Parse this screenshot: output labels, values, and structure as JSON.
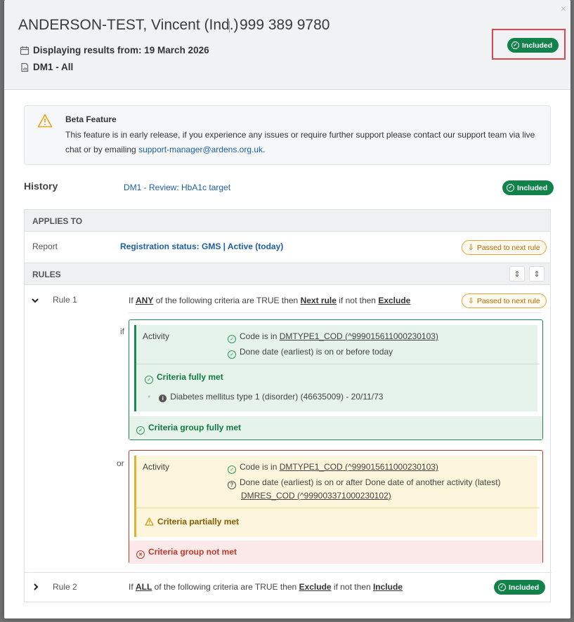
{
  "header": {
    "patient_name": "ANDERSON-TEST, Vincent (Ind.)",
    "nhs_number": "999 389 9780",
    "displaying_label": "Displaying results from: 19 March 2026",
    "report_label": "DM1 - All",
    "status_pill": "Included",
    "close": "×"
  },
  "beta": {
    "title": "Beta Feature",
    "body_prefix": "This feature is in early release, if you experience any issues or require further support please contact our support team via live chat or by emailing ",
    "email": "support-manager@ardens.org.uk",
    "body_suffix": "."
  },
  "history": {
    "label": "History",
    "link": "DM1 - Review: HbA1c target",
    "status_pill": "Included"
  },
  "applies_to": {
    "heading": "APPLIES TO",
    "row_label": "Report",
    "value": "Registration status: GMS | Active (today)",
    "status": "Passed to next rule"
  },
  "rules": {
    "heading": "RULES",
    "rule1": {
      "label": "Rule 1",
      "text_pre": "If ",
      "any": "ANY",
      "text_mid": " of the following criteria are TRUE then ",
      "then": "Next rule",
      "text_mid2": " if not then ",
      "else": "Exclude",
      "status": "Passed to next rule",
      "connector_if": "if",
      "connector_or": "or",
      "group1": {
        "activity_label": "Activity",
        "crit1_pre": "Code is in ",
        "crit1_code": "DMTYPE1_COD",
        "crit1_ref": " (^999015611000230103)",
        "crit2": "Done date (earliest) is on or before today",
        "met_label": "Criteria fully met",
        "evidence": "Diabetes mellitus type 1 (disorder) (46635009) - 20/11/73",
        "footer": "Criteria group fully met"
      },
      "group2": {
        "activity_label": "Activity",
        "crit1_pre": "Code is in ",
        "crit1_code": "DMTYPE1_COD",
        "crit1_ref": " (^999015611000230103)",
        "crit2": "Done date (earliest) is on or after Done date of another activity (latest)",
        "crit2_code": "DMRES_COD",
        "crit2_ref": " (^999003371000230102)",
        "met_label": "Criteria partially met",
        "footer": "Criteria group not met"
      }
    },
    "rule2": {
      "label": "Rule 2",
      "text_pre": "If ",
      "all": "ALL",
      "text_mid": " of the following criteria are TRUE then ",
      "then": "Exclude",
      "text_mid2": " if not then ",
      "else": "Include",
      "status": "Included"
    }
  },
  "colors": {
    "included_green": "#11834a",
    "highlight_red": "#e0454d",
    "link_blue": "#1d5fa6",
    "amber": "#e9a23b"
  }
}
